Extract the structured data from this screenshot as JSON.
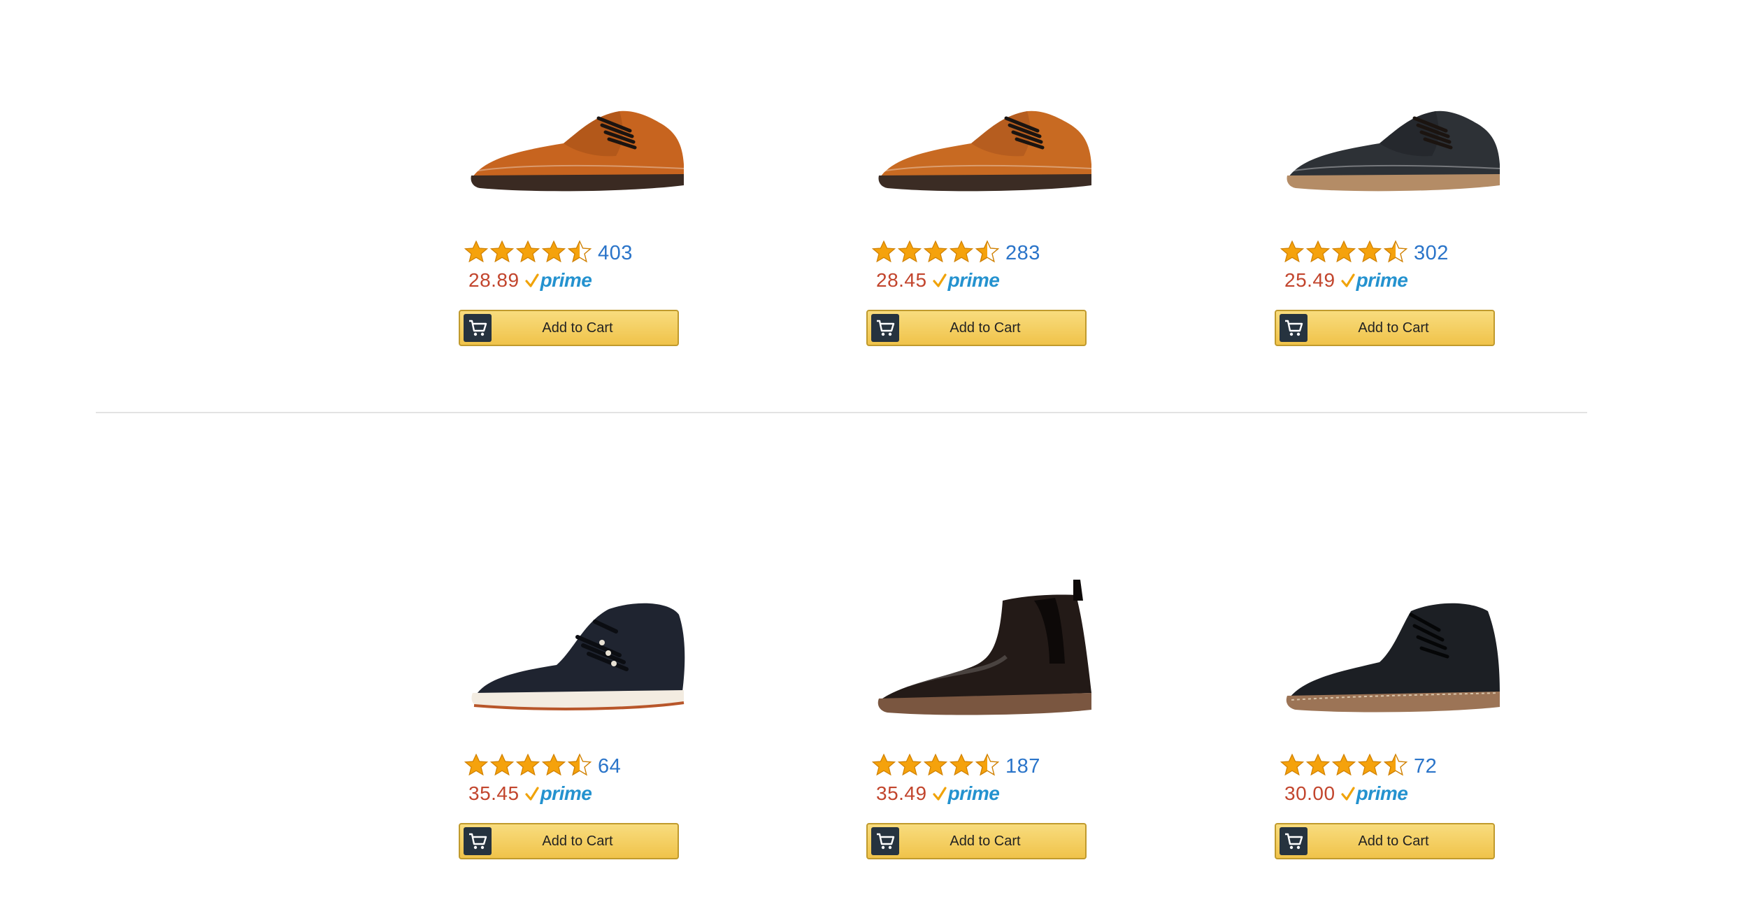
{
  "products": [
    {
      "name": "brown cap-toe oxford",
      "rating": 4.5,
      "reviews": "403",
      "price": "28.89",
      "shoe_type": "oxford",
      "upper": "#c7641f",
      "upper_dark": "#8e4212",
      "sole": "#3a2a22"
    },
    {
      "name": "tan plain-toe derby",
      "rating": 4.5,
      "reviews": "283",
      "price": "28.45",
      "shoe_type": "oxford",
      "upper": "#c86a22",
      "upper_dark": "#94461a",
      "sole": "#3b2c24"
    },
    {
      "name": "black suede oxford",
      "rating": 4.5,
      "reviews": "302",
      "price": "25.49",
      "shoe_type": "oxford",
      "upper": "#2d3136",
      "upper_dark": "#16191c",
      "sole": "#b48c66"
    },
    {
      "name": "navy leather sneaker boot",
      "rating": 4.5,
      "reviews": "64",
      "price": "35.45",
      "shoe_type": "sneaker",
      "upper": "#1f2430",
      "upper_dark": "#0e1118",
      "sole": "#f3ece1"
    },
    {
      "name": "black chelsea boot",
      "rating": 4.5,
      "reviews": "187",
      "price": "35.49",
      "shoe_type": "chelsea",
      "upper": "#231a17",
      "upper_dark": "#0d0908",
      "sole": "#7a5640"
    },
    {
      "name": "black suede chukka",
      "rating": 4.5,
      "reviews": "72",
      "price": "30.00",
      "shoe_type": "chukka",
      "upper": "#1c1f24",
      "upper_dark": "#0a0c0f",
      "sole": "#9c7456"
    }
  ],
  "prime_label": "prime",
  "add_to_cart_label": "Add to Cart",
  "icons": {
    "star": "star-icon",
    "half_star": "half-star-icon",
    "cart": "cart-icon",
    "prime_check": "check-icon"
  },
  "colors": {
    "price": "#c2452d",
    "review_count": "#2a74c9",
    "prime": "#2492cf",
    "button_top": "#f8dc7e",
    "button_bottom": "#f0c34a",
    "star": "#f5a20c"
  }
}
